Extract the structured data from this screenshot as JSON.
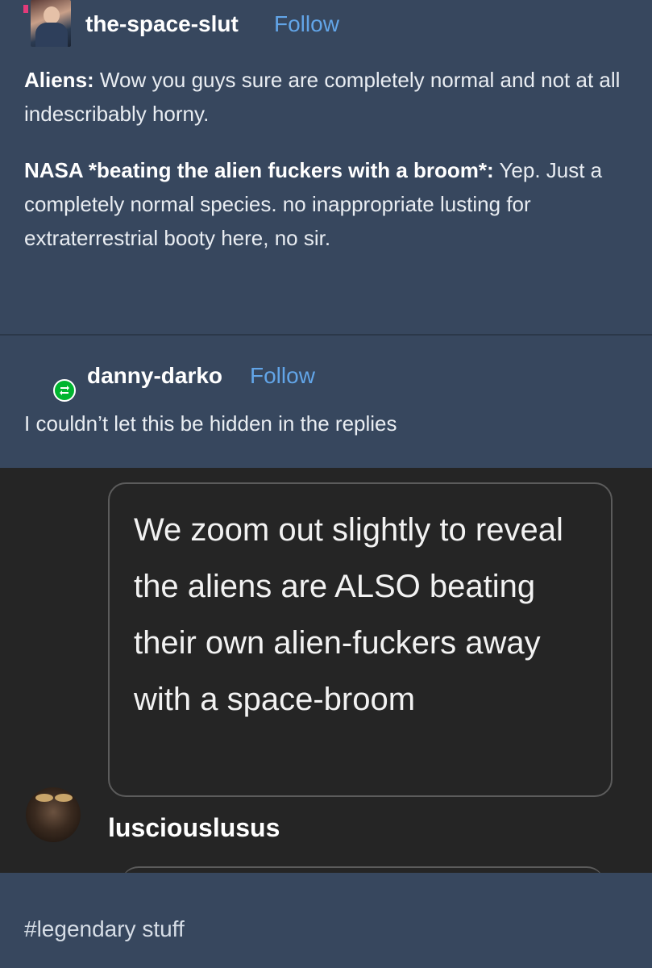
{
  "post": {
    "author": "the-space-slut",
    "follow_label": "Follow",
    "paragraphs": [
      {
        "speaker": "Aliens:",
        "text": " Wow you guys sure are completely normal and not at all indescribably horny."
      },
      {
        "speaker": "NASA *beating the alien fuckers with a broom*:",
        "text": " Yep. Just a completely normal species. no inappropriate lusting for extraterrestrial booty here, no sir."
      }
    ]
  },
  "reblog": {
    "author": "danny-darko",
    "follow_label": "Follow",
    "comment": "I couldn’t let this be hidden in the replies"
  },
  "reply": {
    "text": "We zoom out slightly to reveal the aliens are ALSO beating their own alien-fuckers away with a space-broom",
    "author": "lusciouslusus"
  },
  "tags": [
    "#legendary stuff"
  ],
  "colors": {
    "background": "#37475e",
    "link": "#62a5e8",
    "dark_panel": "#252525",
    "reblog_green": "#00b52f"
  },
  "icons": {
    "reblog": "reblog-icon"
  }
}
